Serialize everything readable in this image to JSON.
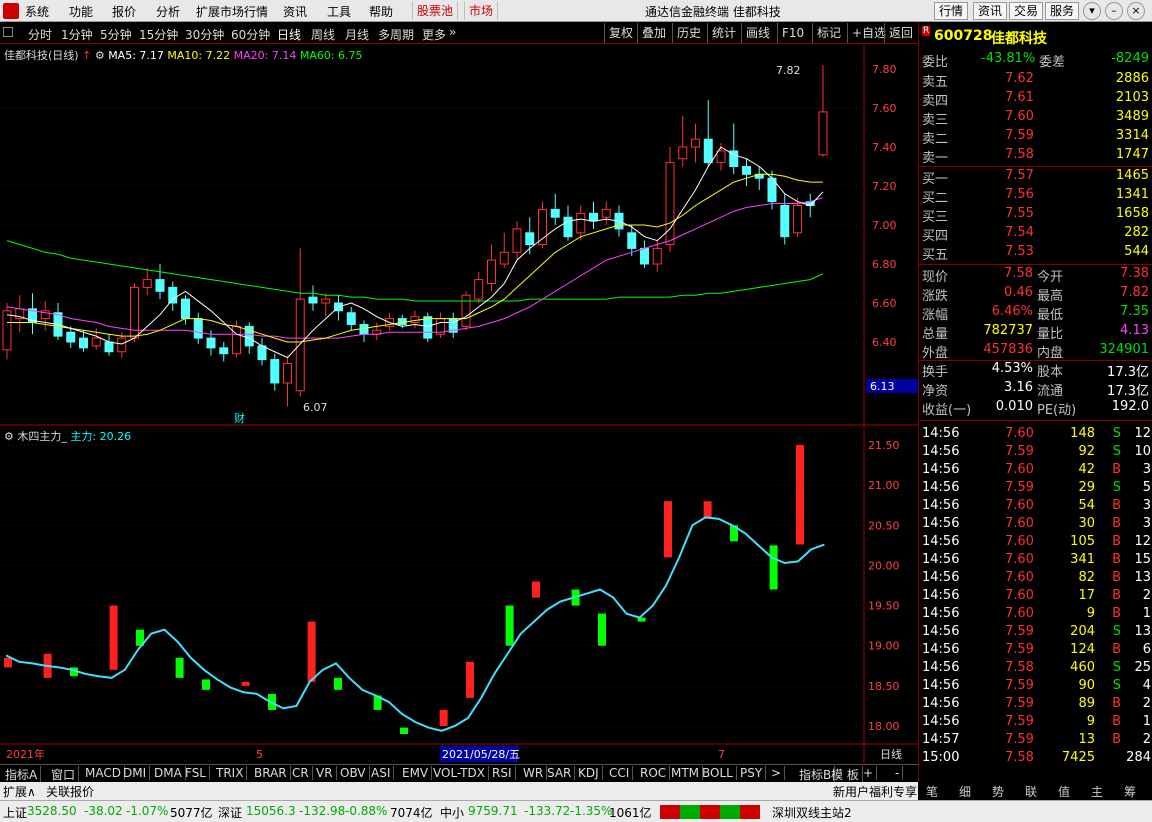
{
  "menu": {
    "items": [
      "系统",
      "功能",
      "报价",
      "分析",
      "扩展市场行情",
      "资讯",
      "工具",
      "帮助"
    ],
    "stockpool": "股票池",
    "market": "市场",
    "title": "通达信金融终端  佳都科技",
    "tabs": [
      "行情",
      "资讯",
      "交易",
      "服务"
    ]
  },
  "toolbar": {
    "periods": [
      "分时",
      "1分钟",
      "5分钟",
      "15分钟",
      "30分钟",
      "60分钟",
      "日线",
      "周线",
      "月线",
      "多周期",
      "更多"
    ],
    "right": [
      "复权",
      "叠加",
      "历史",
      "统计",
      "画线",
      "F10",
      "标记",
      "+自选",
      "返回"
    ]
  },
  "chart_legend": {
    "name": "佳都科技(日线)",
    "ma5": "MA5: 7.17",
    "ma10": "MA10: 7.22",
    "ma20": "MA20: 7.14",
    "ma60": "MA60: 6.75"
  },
  "ind_legend": {
    "name": "木四主力_",
    "value": "主力: 20.26"
  },
  "annotations": {
    "high": "7.82",
    "low": "6.07",
    "cai": "财",
    "price_tag": "6.13"
  },
  "xaxis": {
    "year": "2021年",
    "m5": "5",
    "date": "2021/05/28/五",
    "m7": "7",
    "period": "日线"
  },
  "chart_data": {
    "type": "candlestick",
    "price_ticks": [
      "7.80",
      "7.60",
      "7.40",
      "7.20",
      "7.00",
      "6.80",
      "6.60",
      "6.40"
    ],
    "ind_ticks": [
      "21.50",
      "21.00",
      "20.50",
      "20.00",
      "19.50",
      "19.00",
      "18.50",
      "18.00"
    ],
    "candles": [
      [
        6.36,
        6.56,
        6.6,
        6.31
      ],
      [
        6.52,
        6.57,
        6.64,
        6.45
      ],
      [
        6.57,
        6.5,
        6.65,
        6.44
      ],
      [
        6.52,
        6.56,
        6.61,
        6.46
      ],
      [
        6.55,
        6.43,
        6.6,
        6.41
      ],
      [
        6.45,
        6.4,
        6.48,
        6.37
      ],
      [
        6.42,
        6.37,
        6.46,
        6.35
      ],
      [
        6.38,
        6.42,
        6.47,
        6.36
      ],
      [
        6.4,
        6.35,
        6.44,
        6.33
      ],
      [
        6.35,
        6.42,
        6.45,
        6.32
      ],
      [
        6.42,
        6.68,
        6.7,
        6.4
      ],
      [
        6.68,
        6.72,
        6.78,
        6.64
      ],
      [
        6.72,
        6.66,
        6.8,
        6.62
      ],
      [
        6.68,
        6.6,
        6.71,
        6.56
      ],
      [
        6.62,
        6.52,
        6.64,
        6.49
      ],
      [
        6.52,
        6.42,
        6.55,
        6.39
      ],
      [
        6.42,
        6.37,
        6.46,
        6.33
      ],
      [
        6.37,
        6.34,
        6.4,
        6.3
      ],
      [
        6.34,
        6.48,
        6.51,
        6.32
      ],
      [
        6.48,
        6.38,
        6.5,
        6.34
      ],
      [
        6.38,
        6.31,
        6.42,
        6.28
      ],
      [
        6.31,
        6.19,
        6.34,
        6.15
      ],
      [
        6.19,
        6.29,
        6.33,
        6.07
      ],
      [
        6.15,
        6.62,
        6.88,
        6.12
      ],
      [
        6.63,
        6.6,
        6.69,
        6.56
      ],
      [
        6.6,
        6.62,
        6.65,
        6.53
      ],
      [
        6.6,
        6.56,
        6.64,
        6.51
      ],
      [
        6.55,
        6.49,
        6.58,
        6.46
      ],
      [
        6.49,
        6.44,
        6.51,
        6.4
      ],
      [
        6.44,
        6.46,
        6.5,
        6.41
      ],
      [
        6.48,
        6.52,
        6.55,
        6.46
      ],
      [
        6.52,
        6.49,
        6.54,
        6.47
      ],
      [
        6.5,
        6.53,
        6.56,
        6.47
      ],
      [
        6.53,
        6.42,
        6.55,
        6.4
      ],
      [
        6.44,
        6.52,
        6.55,
        6.42
      ],
      [
        6.52,
        6.45,
        6.55,
        6.42
      ],
      [
        6.48,
        6.64,
        6.66,
        6.46
      ],
      [
        6.62,
        6.72,
        6.76,
        6.6
      ],
      [
        6.7,
        6.82,
        6.9,
        6.66
      ],
      [
        6.8,
        6.86,
        6.96,
        6.78
      ],
      [
        6.86,
        6.98,
        7.02,
        6.82
      ],
      [
        6.96,
        6.9,
        7.04,
        6.85
      ],
      [
        6.9,
        7.08,
        7.12,
        6.88
      ],
      [
        7.08,
        7.04,
        7.16,
        7.0
      ],
      [
        7.04,
        6.94,
        7.1,
        6.92
      ],
      [
        6.96,
        7.06,
        7.1,
        6.92
      ],
      [
        7.06,
        7.02,
        7.12,
        6.98
      ],
      [
        7.04,
        7.08,
        7.12,
        7.0
      ],
      [
        7.06,
        6.98,
        7.1,
        6.94
      ],
      [
        6.96,
        6.88,
        7.0,
        6.84
      ],
      [
        6.88,
        6.8,
        6.92,
        6.78
      ],
      [
        6.8,
        6.88,
        6.92,
        6.76
      ],
      [
        6.9,
        7.32,
        7.4,
        6.86
      ],
      [
        7.34,
        7.4,
        7.56,
        7.3
      ],
      [
        7.4,
        7.44,
        7.52,
        7.32
      ],
      [
        7.44,
        7.32,
        7.64,
        7.3
      ],
      [
        7.32,
        7.38,
        7.42,
        7.28
      ],
      [
        7.38,
        7.3,
        7.52,
        7.26
      ],
      [
        7.3,
        7.26,
        7.34,
        7.2
      ],
      [
        7.26,
        7.24,
        7.3,
        7.18
      ],
      [
        7.24,
        7.12,
        7.28,
        7.08
      ],
      [
        7.1,
        6.94,
        7.16,
        6.9
      ],
      [
        6.96,
        7.1,
        7.14,
        6.94
      ],
      [
        7.12,
        7.1,
        7.16,
        7.04
      ],
      [
        7.36,
        7.58,
        7.82,
        7.35
      ]
    ],
    "ma5": [
      6.54,
      6.53,
      6.51,
      6.5,
      6.49,
      6.47,
      6.45,
      6.43,
      6.4,
      6.39,
      6.42,
      6.48,
      6.54,
      6.62,
      6.66,
      6.61,
      6.56,
      6.5,
      6.44,
      6.42,
      6.38,
      6.35,
      6.32,
      6.39,
      6.46,
      6.52,
      6.58,
      6.6,
      6.57,
      6.53,
      6.5,
      6.48,
      6.49,
      6.48,
      6.5,
      6.5,
      6.53,
      6.58,
      6.63,
      6.7,
      6.82,
      6.88,
      6.93,
      6.98,
      7.02,
      7.03,
      7.02,
      7.03,
      7.02,
      6.99,
      6.94,
      6.92,
      6.98,
      7.08,
      7.18,
      7.3,
      7.4,
      7.36,
      7.34,
      7.3,
      7.24,
      7.16,
      7.12,
      7.1,
      7.17
    ],
    "ma10": [
      6.5,
      6.5,
      6.5,
      6.49,
      6.48,
      6.47,
      6.46,
      6.45,
      6.44,
      6.43,
      6.43,
      6.44,
      6.46,
      6.49,
      6.52,
      6.52,
      6.51,
      6.49,
      6.48,
      6.46,
      6.44,
      6.42,
      6.4,
      6.4,
      6.41,
      6.42,
      6.44,
      6.46,
      6.47,
      6.48,
      6.49,
      6.5,
      6.51,
      6.52,
      6.52,
      6.52,
      6.52,
      6.55,
      6.58,
      6.62,
      6.68,
      6.74,
      6.8,
      6.86,
      6.9,
      6.94,
      6.96,
      6.98,
      7.0,
      7.0,
      7.0,
      6.99,
      7.01,
      7.05,
      7.1,
      7.14,
      7.18,
      7.22,
      7.24,
      7.26,
      7.26,
      7.25,
      7.23,
      7.22,
      7.22
    ],
    "ma20": [
      6.58,
      6.57,
      6.56,
      6.55,
      6.54,
      6.52,
      6.51,
      6.5,
      6.48,
      6.47,
      6.46,
      6.46,
      6.46,
      6.46,
      6.46,
      6.45,
      6.44,
      6.44,
      6.44,
      6.44,
      6.43,
      6.43,
      6.42,
      6.42,
      6.42,
      6.42,
      6.42,
      6.43,
      6.44,
      6.44,
      6.45,
      6.45,
      6.45,
      6.45,
      6.45,
      6.46,
      6.47,
      6.48,
      6.5,
      6.52,
      6.55,
      6.58,
      6.62,
      6.66,
      6.7,
      6.74,
      6.78,
      6.82,
      6.84,
      6.86,
      6.88,
      6.9,
      6.92,
      6.95,
      6.98,
      7.01,
      7.04,
      7.07,
      7.09,
      7.1,
      7.11,
      7.11,
      7.11,
      7.12,
      7.14
    ],
    "ma60": [
      6.92,
      6.9,
      6.88,
      6.86,
      6.85,
      6.83,
      6.82,
      6.81,
      6.8,
      6.79,
      6.78,
      6.77,
      6.76,
      6.75,
      6.74,
      6.73,
      6.72,
      6.71,
      6.7,
      6.69,
      6.68,
      6.67,
      6.66,
      6.65,
      6.65,
      6.64,
      6.64,
      6.63,
      6.63,
      6.62,
      6.62,
      6.62,
      6.61,
      6.61,
      6.61,
      6.61,
      6.61,
      6.61,
      6.61,
      6.61,
      6.61,
      6.62,
      6.62,
      6.62,
      6.62,
      6.62,
      6.62,
      6.62,
      6.63,
      6.63,
      6.63,
      6.63,
      6.63,
      6.64,
      6.64,
      6.65,
      6.65,
      6.66,
      6.67,
      6.68,
      6.69,
      6.7,
      6.71,
      6.72,
      6.75
    ],
    "indicator": [
      18.88,
      18.8,
      18.78,
      18.75,
      18.73,
      18.7,
      18.65,
      18.62,
      18.6,
      18.7,
      18.95,
      19.15,
      19.2,
      19.05,
      18.85,
      18.7,
      18.58,
      18.48,
      18.42,
      18.4,
      18.3,
      18.22,
      18.25,
      18.55,
      18.7,
      18.78,
      18.6,
      18.45,
      18.38,
      18.3,
      18.15,
      18.05,
      17.98,
      17.94,
      18.0,
      18.1,
      18.35,
      18.65,
      18.9,
      19.15,
      19.3,
      19.45,
      19.55,
      19.6,
      19.65,
      19.7,
      19.6,
      19.4,
      19.35,
      19.5,
      19.75,
      20.1,
      20.5,
      20.6,
      20.58,
      20.5,
      20.4,
      20.25,
      20.1,
      20.03,
      20.05,
      20.2,
      20.26
    ],
    "ind_bars": [
      [
        18.73,
        18.85
      ],
      [
        18.6,
        18.9
      ],
      [
        18.73,
        18.62
      ],
      [
        18.7,
        19.5
      ],
      [
        19.2,
        19.0
      ],
      [
        18.85,
        18.6
      ],
      [
        18.58,
        18.45
      ],
      [
        18.5,
        18.55
      ],
      [
        18.4,
        18.2
      ],
      [
        18.55,
        19.3
      ],
      [
        18.6,
        18.45
      ],
      [
        18.38,
        18.2
      ],
      [
        17.98,
        17.9
      ],
      [
        18.0,
        18.2
      ],
      [
        18.35,
        18.8
      ],
      [
        19.5,
        19.0
      ],
      [
        19.6,
        19.8
      ],
      [
        19.7,
        19.5
      ],
      [
        19.4,
        19.0
      ],
      [
        19.35,
        19.3
      ],
      [
        20.1,
        20.8
      ],
      [
        20.58,
        20.8
      ],
      [
        20.5,
        20.3
      ],
      [
        20.25,
        19.7
      ],
      [
        20.26,
        21.5
      ]
    ]
  },
  "quote": {
    "code": "600728",
    "name": "佳都科技",
    "weibi_l": "委比",
    "weibi": "-43.81%",
    "weicha_l": "委差",
    "weicha": "-8249",
    "asks": [
      [
        "卖五",
        "7.62",
        "2886"
      ],
      [
        "卖四",
        "7.61",
        "2103"
      ],
      [
        "卖三",
        "7.60",
        "3489"
      ],
      [
        "卖二",
        "7.59",
        "3314"
      ],
      [
        "卖一",
        "7.58",
        "1747"
      ]
    ],
    "bids": [
      [
        "买一",
        "7.57",
        "1465"
      ],
      [
        "买二",
        "7.56",
        "1341"
      ],
      [
        "买三",
        "7.55",
        "1658"
      ],
      [
        "买四",
        "7.54",
        "282"
      ],
      [
        "买五",
        "7.53",
        "544"
      ]
    ],
    "stats": [
      [
        "现价",
        "7.58",
        "今开",
        "7.38"
      ],
      [
        "涨跌",
        "0.46",
        "最高",
        "7.82"
      ],
      [
        "涨幅",
        "6.46%",
        "最低",
        "7.35"
      ],
      [
        "总量",
        "782737",
        "量比",
        "4.13"
      ],
      [
        "外盘",
        "457836",
        "内盘",
        "324901"
      ],
      [
        "换手",
        "4.53%",
        "股本",
        "17.3亿"
      ],
      [
        "净资",
        "3.16",
        "流通",
        "17.3亿"
      ],
      [
        "收益(一)",
        "0.010",
        "PE(动)",
        "192.0"
      ]
    ],
    "ticks": [
      [
        "14:56",
        "7.60",
        "148",
        "S",
        "12"
      ],
      [
        "14:56",
        "7.59",
        "92",
        "S",
        "10"
      ],
      [
        "14:56",
        "7.60",
        "42",
        "B",
        "3"
      ],
      [
        "14:56",
        "7.59",
        "29",
        "S",
        "5"
      ],
      [
        "14:56",
        "7.60",
        "54",
        "B",
        "3"
      ],
      [
        "14:56",
        "7.60",
        "30",
        "B",
        "3"
      ],
      [
        "14:56",
        "7.60",
        "105",
        "B",
        "12"
      ],
      [
        "14:56",
        "7.60",
        "341",
        "B",
        "15"
      ],
      [
        "14:56",
        "7.60",
        "82",
        "B",
        "13"
      ],
      [
        "14:56",
        "7.60",
        "17",
        "B",
        "2"
      ],
      [
        "14:56",
        "7.60",
        "9",
        "B",
        "1"
      ],
      [
        "14:56",
        "7.59",
        "204",
        "S",
        "13"
      ],
      [
        "14:56",
        "7.59",
        "124",
        "B",
        "6"
      ],
      [
        "14:56",
        "7.58",
        "460",
        "S",
        "25"
      ],
      [
        "14:56",
        "7.59",
        "90",
        "S",
        "4"
      ],
      [
        "14:56",
        "7.59",
        "89",
        "B",
        "2"
      ],
      [
        "14:56",
        "7.59",
        "9",
        "B",
        "1"
      ],
      [
        "14:57",
        "7.59",
        "13",
        "B",
        "2"
      ],
      [
        "15:00",
        "7.58",
        "7425",
        "",
        "284"
      ]
    ]
  },
  "bottom_tabs": [
    "指标A",
    "窗口",
    "MACD",
    "DMI",
    "DMA",
    "FSL",
    "TRIX",
    "BRAR",
    "CR",
    "VR",
    "OBV",
    "ASI",
    "EMV",
    "VOL-TDX",
    "RSI",
    "WR",
    "SAR",
    "KDJ",
    "CCI",
    "ROC",
    "MTM",
    "BOLL",
    "PSY",
    ">",
    "指标B",
    "模 板",
    "+",
    "-"
  ],
  "status": {
    "ext": "扩展∧",
    "related": "关联报价",
    "notice": "新用户福利专享",
    "sh_l": "上证",
    "sh": "3528.50",
    "sh_c": "-38.02",
    "sh_p": "-1.07%",
    "sh_v": "5077亿",
    "sz_l": "深证",
    "sz": "15056.3",
    "sz_c": "-132.98",
    "sz_p": "-0.88%",
    "sz_v": "7074亿",
    "zx_l": "中小",
    "zx": "9759.71",
    "zx_c": "-133.72",
    "zx_p": "-1.35%",
    "zx_v": "1061亿",
    "server": "深圳双线主站2"
  },
  "panel_tabs": [
    "笔",
    "细",
    "势",
    "联",
    "值",
    "主",
    "筹"
  ]
}
